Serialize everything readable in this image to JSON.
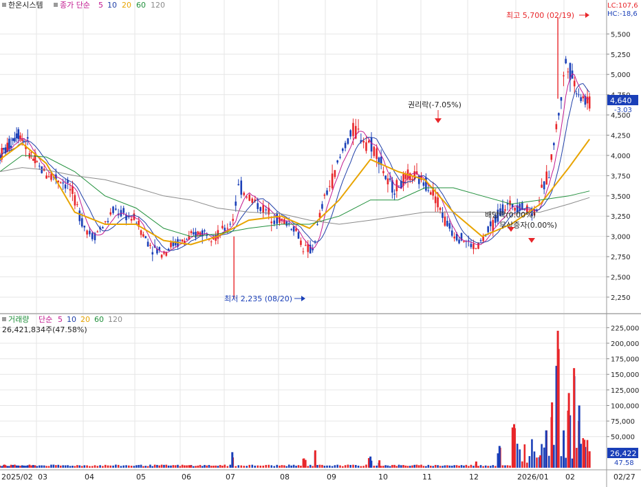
{
  "header": {
    "stock_name": "한온시스템",
    "price_legend": {
      "prefix": "종가 단순",
      "periods": [
        "5",
        "10",
        "20",
        "60",
        "120"
      ]
    },
    "lc_label": "LC:107,6",
    "hc_label": "HC:-18,6"
  },
  "volume_header": {
    "title": "거래량",
    "prefix": "단순",
    "periods": [
      "5",
      "10",
      "20",
      "60",
      "120"
    ],
    "current_volume": "26,421,834주(47.58%)"
  },
  "annotations": {
    "high": "최고 5,700 (02/19)",
    "low": "최저 2,235 (08/20)",
    "ex_rights": "권리락(-7.05%)",
    "ex_dividend": "배당락(0.00%)",
    "bonus_issue": "무상증자(0.00%)"
  },
  "price_tags": {
    "last": "4,640",
    "change": "-3.03"
  },
  "volume_tags": {
    "last": "26,422",
    "ratio": "47.58"
  },
  "colors": {
    "up": "#e8262a",
    "down": "#1a3fb8",
    "ma5": "#c2188f",
    "ma10": "#1f3fa8",
    "ma20": "#e8a400",
    "ma60": "#1f8f3a",
    "ma120": "#8a8a8a",
    "grid": "#e6e6e6",
    "axis": "#888888"
  },
  "chart_data": [
    {
      "type": "candlestick",
      "title": "한온시스템",
      "period": "2025/02 – 2026/02",
      "x_tick_labels": [
        "2025/02",
        "03",
        "04",
        "05",
        "06",
        "07",
        "08",
        "09",
        "10",
        "11",
        "12",
        "2026/01",
        "02",
        "02/27"
      ],
      "y_ticks": [
        2250,
        2500,
        2750,
        3000,
        3250,
        3500,
        3750,
        4000,
        4250,
        4500,
        4750,
        5000,
        5250,
        5500
      ],
      "y_tick_labels": [
        "2,250",
        "2,500",
        "2,750",
        "3,000",
        "3,250",
        "3,500",
        "3,750",
        "4,000",
        "4,250",
        "4,500",
        "4,750",
        "5,000",
        "5,250",
        "5,500"
      ],
      "ylim": [
        2080,
        5800
      ],
      "moving_averages": [
        "5",
        "10",
        "20",
        "60",
        "120"
      ],
      "last_close": 4640,
      "high": {
        "value": 5700,
        "date": "02/19"
      },
      "low": {
        "value": 2235,
        "date": "08/20"
      },
      "close_series": {
        "month_index": [
          0,
          0.4,
          0.8,
          1.2,
          1.5,
          1.8,
          2.2,
          2.5,
          2.8,
          3.0,
          3.3,
          3.6,
          4.0,
          4.3,
          4.6,
          5.0,
          5.3,
          5.6,
          6.0,
          6.3,
          6.6,
          7.0,
          7.3,
          7.6,
          8.0,
          8.3,
          8.5,
          8.7,
          9.0,
          9.3,
          9.6,
          9.9,
          10.2,
          10.5,
          10.8,
          11.1,
          11.5,
          11.8,
          12.2,
          12.5,
          12.8,
          13.0,
          13.3,
          13.6,
          13.9,
          14.2,
          14.5,
          14.8,
          15.1,
          15.4,
          15.7,
          16.0,
          16.4,
          16.8,
          17.2,
          17.7,
          18.2,
          18.8,
          19.3,
          19.6,
          19.9,
          20.2,
          20.5,
          20.8
        ],
        "close": [
          4000,
          4120,
          4300,
          4150,
          3950,
          3830,
          3750,
          3700,
          3620,
          3450,
          3150,
          3000,
          3150,
          3330,
          3270,
          3200,
          3000,
          2860,
          2800,
          2900,
          2930,
          2980,
          3050,
          3050,
          3000,
          3100,
          3200,
          3620,
          3500,
          3380,
          3290,
          3210,
          3170,
          3100,
          2850,
          2830,
          3450,
          3720,
          4150,
          4320,
          4200,
          4150,
          3980,
          3650,
          3600,
          3680,
          3750,
          3700,
          3650,
          3480,
          3200,
          3050,
          2950,
          2850,
          3050,
          3350,
          3400,
          3300,
          3800,
          4450,
          5200,
          4900,
          4720,
          4640
        ]
      },
      "ma_series": {
        "month_index": [
          0,
          1,
          2,
          3,
          4,
          5,
          6,
          7,
          8,
          9,
          10,
          11,
          12,
          13,
          14,
          15,
          16,
          17,
          18,
          19,
          20,
          20.8
        ],
        "ma20": [
          3950,
          4150,
          3900,
          3300,
          3150,
          3150,
          2950,
          2900,
          3000,
          3200,
          3250,
          3100,
          3450,
          3950,
          3800,
          3700,
          3300,
          3000,
          3150,
          3400,
          3850,
          4200
        ],
        "ma60": [
          3800,
          4000,
          3980,
          3800,
          3500,
          3350,
          3100,
          3000,
          3030,
          3100,
          3150,
          3150,
          3250,
          3450,
          3450,
          3600,
          3600,
          3500,
          3400,
          3450,
          3500,
          3560
        ],
        "ma120": [
          3800,
          3850,
          3820,
          3750,
          3700,
          3600,
          3500,
          3450,
          3350,
          3300,
          3280,
          3200,
          3150,
          3200,
          3250,
          3300,
          3300,
          3300,
          3280,
          3300,
          3400,
          3480
        ]
      }
    },
    {
      "type": "bar",
      "title": "거래량",
      "y_ticks": [
        50000,
        75000,
        100000,
        125000,
        150000,
        175000,
        200000,
        225000
      ],
      "y_tick_labels": [
        "50,000",
        "75,000",
        "100,000",
        "125,000",
        "150,000",
        "175,000",
        "200,000",
        "225,000"
      ],
      "ylim": [
        0,
        232000
      ],
      "unit": "thousand shares",
      "last_volume": 26422,
      "peak_series": {
        "month_index": [
          0.2,
          7.0,
          8.5,
          10.8,
          11.2,
          13.0,
          13.3,
          16.8,
          17.6,
          18.1,
          19.0,
          19.2,
          19.4,
          19.6,
          19.8,
          20.0,
          20.2,
          20.4,
          20.6,
          20.8
        ],
        "volume": [
          5000,
          4000,
          25000,
          15000,
          28000,
          18000,
          12000,
          10000,
          35000,
          70000,
          20000,
          60000,
          105000,
          220000,
          60000,
          120000,
          160000,
          100000,
          45000,
          26422
        ]
      }
    }
  ]
}
